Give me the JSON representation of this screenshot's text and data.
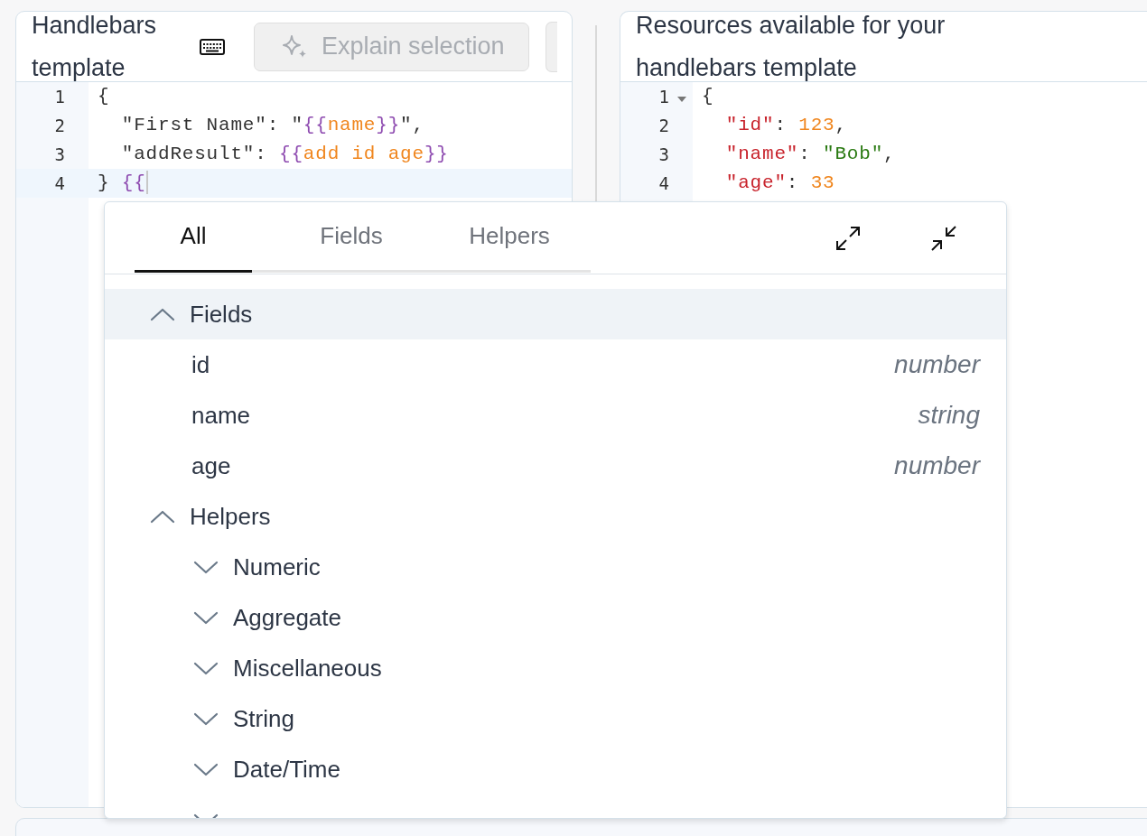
{
  "editor": {
    "title": "Handlebars template",
    "explain_button": {
      "label": "Explain selection",
      "disabled": true
    },
    "lines": [
      {
        "number": "1",
        "active": false,
        "tokens": [
          {
            "kind": "punct",
            "text": "{"
          }
        ]
      },
      {
        "number": "2",
        "active": false,
        "tokens": [
          {
            "kind": "punct",
            "text": "  \"First Name\": \""
          },
          {
            "kind": "brace",
            "text": "{{"
          },
          {
            "kind": "expr",
            "text": "name"
          },
          {
            "kind": "brace",
            "text": "}}"
          },
          {
            "kind": "punct",
            "text": "\","
          }
        ]
      },
      {
        "number": "3",
        "active": false,
        "tokens": [
          {
            "kind": "punct",
            "text": "  \"addResult\": "
          },
          {
            "kind": "brace",
            "text": "{{"
          },
          {
            "kind": "expr",
            "text": "add id age"
          },
          {
            "kind": "brace",
            "text": "}}"
          }
        ]
      },
      {
        "number": "4",
        "active": true,
        "tokens": [
          {
            "kind": "punct",
            "text": "} "
          },
          {
            "kind": "brace",
            "text": "{{"
          }
        ]
      }
    ]
  },
  "resources": {
    "title": "Resources available for your handlebars template",
    "lines": [
      {
        "number": "1",
        "foldable": true,
        "tokens": [
          {
            "kind": "punct",
            "text": "{"
          }
        ]
      },
      {
        "number": "2",
        "foldable": false,
        "tokens": [
          {
            "kind": "key",
            "text": "  \"id\""
          },
          {
            "kind": "punct",
            "text": ": "
          },
          {
            "kind": "number",
            "text": "123"
          },
          {
            "kind": "punct",
            "text": ","
          }
        ]
      },
      {
        "number": "3",
        "foldable": false,
        "tokens": [
          {
            "kind": "key",
            "text": "  \"name\""
          },
          {
            "kind": "punct",
            "text": ": "
          },
          {
            "kind": "string",
            "text": "\"Bob\""
          },
          {
            "kind": "punct",
            "text": ","
          }
        ]
      },
      {
        "number": "4",
        "foldable": false,
        "tokens": [
          {
            "kind": "key",
            "text": "  \"age\""
          },
          {
            "kind": "punct",
            "text": ": "
          },
          {
            "kind": "number",
            "text": "33"
          }
        ]
      }
    ]
  },
  "autocomplete": {
    "tabs": [
      {
        "label": "All",
        "selected": true
      },
      {
        "label": "Fields",
        "selected": false
      },
      {
        "label": "Helpers",
        "selected": false
      }
    ],
    "groups": [
      {
        "label": "Fields",
        "expanded": true,
        "highlighted": true,
        "items": [
          {
            "name": "id",
            "type": "number"
          },
          {
            "name": "name",
            "type": "string"
          },
          {
            "name": "age",
            "type": "number"
          }
        ]
      },
      {
        "label": "Helpers",
        "expanded": true,
        "highlighted": false,
        "children": [
          {
            "label": "Numeric",
            "expanded": false
          },
          {
            "label": "Aggregate",
            "expanded": false
          },
          {
            "label": "Miscellaneous",
            "expanded": false
          },
          {
            "label": "String",
            "expanded": false
          },
          {
            "label": "Date/Time",
            "expanded": false
          },
          {
            "expanded": false
          }
        ]
      }
    ]
  }
}
